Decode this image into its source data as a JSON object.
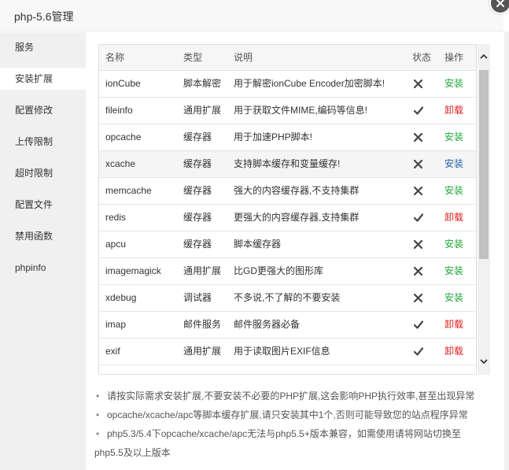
{
  "dialog": {
    "title": "php-5.6管理"
  },
  "sidebar": {
    "items": [
      {
        "label": "服务"
      },
      {
        "label": "安装扩展"
      },
      {
        "label": "配置修改"
      },
      {
        "label": "上传限制"
      },
      {
        "label": "超时限制"
      },
      {
        "label": "配置文件"
      },
      {
        "label": "禁用函数"
      },
      {
        "label": "phpinfo"
      }
    ],
    "active_index": 1
  },
  "table": {
    "headers": {
      "name": "名称",
      "type": "类型",
      "desc": "说明",
      "status": "状态",
      "op": "操作"
    },
    "rows": [
      {
        "name": "ionCube",
        "type": "脚本解密",
        "desc": "用于解密ionCube Encoder加密脚本!",
        "status": "not-installed",
        "op": "安装"
      },
      {
        "name": "fileinfo",
        "type": "通用扩展",
        "desc": "用于获取文件MIME,编码等信息!",
        "status": "installed",
        "op": "卸载"
      },
      {
        "name": "opcache",
        "type": "缓存器",
        "desc": "用于加速PHP脚本!",
        "status": "not-installed",
        "op": "安装"
      },
      {
        "name": "xcache",
        "type": "缓存器",
        "desc": "支持脚本缓存和变量缓存!",
        "status": "not-installed",
        "op": "安装"
      },
      {
        "name": "memcache",
        "type": "缓存器",
        "desc": "强大的内容缓存器,不支持集群",
        "status": "not-installed",
        "op": "安装"
      },
      {
        "name": "redis",
        "type": "缓存器",
        "desc": "更强大的内容缓存器,支持集群",
        "status": "installed",
        "op": "卸载"
      },
      {
        "name": "apcu",
        "type": "缓存器",
        "desc": "脚本缓存器",
        "status": "not-installed",
        "op": "安装"
      },
      {
        "name": "imagemagick",
        "type": "通用扩展",
        "desc": "比GD更强大的图形库",
        "status": "not-installed",
        "op": "安装"
      },
      {
        "name": "xdebug",
        "type": "调试器",
        "desc": "不多说,不了解的不要安装",
        "status": "not-installed",
        "op": "安装"
      },
      {
        "name": "imap",
        "type": "邮件服务",
        "desc": "邮件服务器必备",
        "status": "installed",
        "op": "卸载"
      },
      {
        "name": "exif",
        "type": "通用扩展",
        "desc": "用于读取图片EXIF信息",
        "status": "installed",
        "op": "卸载"
      }
    ]
  },
  "notes": [
    "请按实际需求安装扩展,不要安装不必要的PHP扩展,这会影响PHP执行效率,甚至出现异常",
    "opcache/xcache/apc等脚本缓存扩展,请只安装其中1个,否则可能导致您的站点程序异常",
    "php5.3/5.4下opcache/xcache/apc无法与php5.5+版本兼容，如需使用请将网站切换至",
    "php5.5及以上版本"
  ],
  "colors": {
    "install": "#20a53a",
    "uninstall": "#e02020",
    "install_hover": "#2a5ea8"
  }
}
